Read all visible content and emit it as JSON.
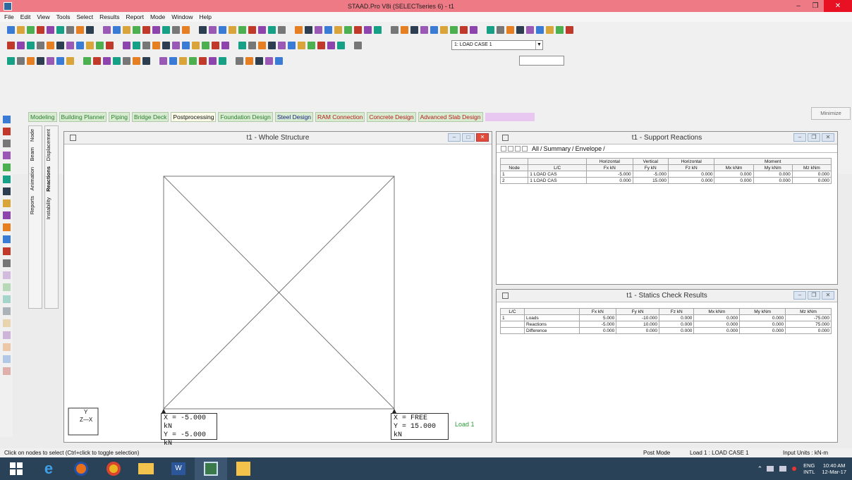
{
  "title": "STAAD.Pro V8i (SELECTseries 6) - t1",
  "menu": [
    "File",
    "Edit",
    "View",
    "Tools",
    "Select",
    "Results",
    "Report",
    "Mode",
    "Window",
    "Help"
  ],
  "loadcase_combo": "1: LOAD CASE 1",
  "tabs": [
    {
      "label": "Modeling",
      "color": "#2e7d32"
    },
    {
      "label": "Building Planner",
      "color": "#2e7d32"
    },
    {
      "label": "Piping",
      "color": "#2e7d32"
    },
    {
      "label": "Bridge Deck",
      "color": "#2e7d32"
    },
    {
      "label": "Postprocessing",
      "color": "#111111"
    },
    {
      "label": "Foundation Design",
      "color": "#2e7d32"
    },
    {
      "label": "Steel Design",
      "color": "#1a237e"
    },
    {
      "label": "RAM Connection",
      "color": "#b71c1c"
    },
    {
      "label": "Concrete Design",
      "color": "#b71c1c"
    },
    {
      "label": "Advanced Slab Design",
      "color": "#b71c1c"
    }
  ],
  "minimize_label": "Minimize",
  "vpanel1": [
    "Node",
    "Beam",
    "Animation",
    "Reports"
  ],
  "vpanel2": [
    "Displacement",
    "Reactions",
    "Instability"
  ],
  "structure_window": {
    "title": "t1 - Whole Structure",
    "left_reaction": [
      "X = -5.000 kN",
      "Y = -5.000 kN"
    ],
    "right_reaction": [
      "X = FREE",
      "Y = 15.000 kN"
    ],
    "load_label": "Load 1",
    "axis_y": "Y",
    "axis_x": "Z—X"
  },
  "support_window": {
    "title": "t1 - Support Reactions",
    "subtabs": [
      "All",
      "Summary",
      "Envelope"
    ],
    "group_headers": [
      "Horizontal",
      "Vertical",
      "Horizontal",
      "Moment"
    ],
    "headers": [
      "Node",
      "L/C",
      "Fx kN",
      "Fy kN",
      "Fz kN",
      "Mx kNm",
      "My kNm",
      "Mz kNm"
    ],
    "rows": [
      [
        "1",
        "1 LOAD CAS",
        "-5.000",
        "-5.000",
        "0.000",
        "0.000",
        "0.000",
        "0.000"
      ],
      [
        "2",
        "1 LOAD CAS",
        "0.000",
        "15.000",
        "0.000",
        "0.000",
        "0.000",
        "0.000"
      ]
    ]
  },
  "statics_window": {
    "title": "t1 - Statics Check Results",
    "headers": [
      "L/C",
      "",
      "Fx kN",
      "Fy kN",
      "Fz kN",
      "Mx kNm",
      "My kNm",
      "Mz kNm"
    ],
    "rows": [
      [
        "1",
        "Loads",
        "5.000",
        "-10.000",
        "0.000",
        "0.000",
        "0.000",
        "-75.000"
      ],
      [
        "",
        "Reactions",
        "-5.000",
        "10.000",
        "0.000",
        "0.000",
        "0.000",
        "75.000"
      ],
      [
        "",
        "Difference",
        "0.000",
        "0.000",
        "0.000",
        "0.000",
        "0.000",
        "0.000"
      ]
    ]
  },
  "status": {
    "hint": "Click on nodes to select (Ctrl+click to toggle selection)",
    "mode": "Post Mode",
    "load": "Load 1 : LOAD CASE 1",
    "units": "Input Units : kN-m"
  },
  "tray": {
    "lang1": "ENG",
    "lang2": "INTL",
    "time": "10:40 AM",
    "date": "12-Mar-17"
  }
}
